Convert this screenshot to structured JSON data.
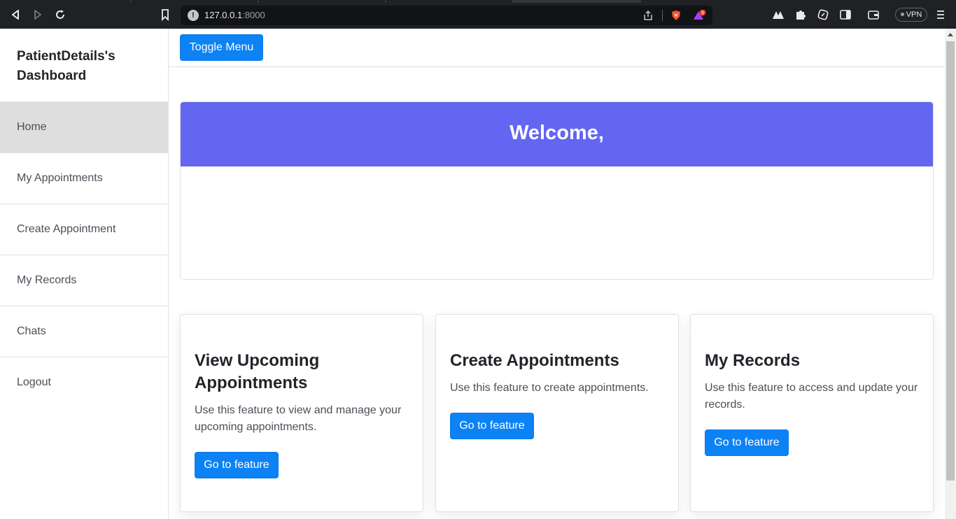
{
  "browser": {
    "url_host": "127.0.0.1",
    "url_port": ":8000",
    "vpn_label": "VPN",
    "brave_badge": "9"
  },
  "sidebar": {
    "heading": "PatientDetails's Dashboard",
    "items": [
      {
        "label": "Home"
      },
      {
        "label": "My Appointments"
      },
      {
        "label": "Create Appointment"
      },
      {
        "label": "My Records"
      },
      {
        "label": "Chats"
      },
      {
        "label": "Logout"
      }
    ]
  },
  "topbar": {
    "toggle_label": "Toggle Menu"
  },
  "welcome": {
    "title": "Welcome,"
  },
  "features": [
    {
      "title": "View Upcoming Appointments",
      "description": "Use this feature to view and manage your upcoming appointments.",
      "button": "Go to feature"
    },
    {
      "title": "Create Appointments",
      "description": "Use this feature to create appointments.",
      "button": "Go to feature"
    },
    {
      "title": "My Records",
      "description": "Use this feature to access and update your records.",
      "button": "Go to feature"
    }
  ],
  "colors": {
    "primary": "#0d82f5",
    "welcome_header": "#6366f1",
    "active_item": "#dedede"
  }
}
